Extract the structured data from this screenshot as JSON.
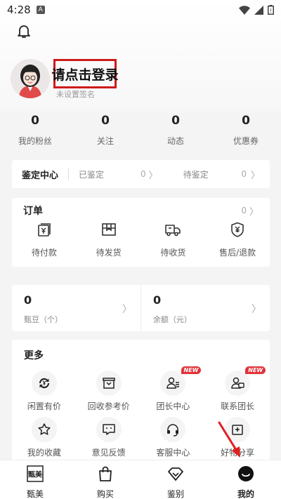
{
  "status_bar": {
    "time": "4:28",
    "badge": "A",
    "icons": [
      "wifi-icon",
      "signal-icon",
      "battery-icon"
    ]
  },
  "profile": {
    "login_prompt": "请点击登录",
    "signature": "未设置签名"
  },
  "stats": [
    {
      "value": "0",
      "label": "我的粉丝"
    },
    {
      "value": "0",
      "label": "关注"
    },
    {
      "value": "0",
      "label": "动态"
    },
    {
      "value": "0",
      "label": "优惠券"
    }
  ],
  "appraisal": {
    "title": "鉴定中心",
    "appraised_label": "已鉴定",
    "appraised_count": "0",
    "pending_label": "待鉴定",
    "pending_count": "0"
  },
  "orders": {
    "title": "订单",
    "count": "0",
    "items": [
      {
        "label": "待付款",
        "icon": "wallet-yen-icon"
      },
      {
        "label": "待发货",
        "icon": "package-icon"
      },
      {
        "label": "待收货",
        "icon": "truck-icon"
      },
      {
        "label": "售后/退款",
        "icon": "shield-yen-icon"
      }
    ]
  },
  "wallet": {
    "beans_value": "0",
    "beans_label": "甄豆（个）",
    "balance_value": "0",
    "balance_label": "余额（元）"
  },
  "more": {
    "title": "更多",
    "new_tag": "NEW",
    "items": [
      {
        "label": "闲置有价",
        "icon": "exchange-yen-icon"
      },
      {
        "label": "回收参考价",
        "icon": "recycle-box-icon"
      },
      {
        "label": "团长中心",
        "icon": "leader-icon",
        "new": true
      },
      {
        "label": "联系团长",
        "icon": "contact-leader-icon",
        "new": true
      },
      {
        "label": "我的收藏",
        "icon": "star-icon"
      },
      {
        "label": "意见反馈",
        "icon": "feedback-icon"
      },
      {
        "label": "客服中心",
        "icon": "headset-icon"
      },
      {
        "label": "好物分享",
        "icon": "share-icon"
      }
    ]
  },
  "tabbar": [
    {
      "label": "甄美",
      "icon": "zhenmei-logo-icon",
      "logo_text": "甄美"
    },
    {
      "label": "购买",
      "icon": "shopping-bag-icon"
    },
    {
      "label": "鉴别",
      "icon": "diamond-icon"
    },
    {
      "label": "我的",
      "icon": "smile-icon",
      "active": true
    }
  ],
  "colors": {
    "highlight_box": "#cc1b1b",
    "new_tag": "#e0333a",
    "background": "#f4f4f5"
  }
}
